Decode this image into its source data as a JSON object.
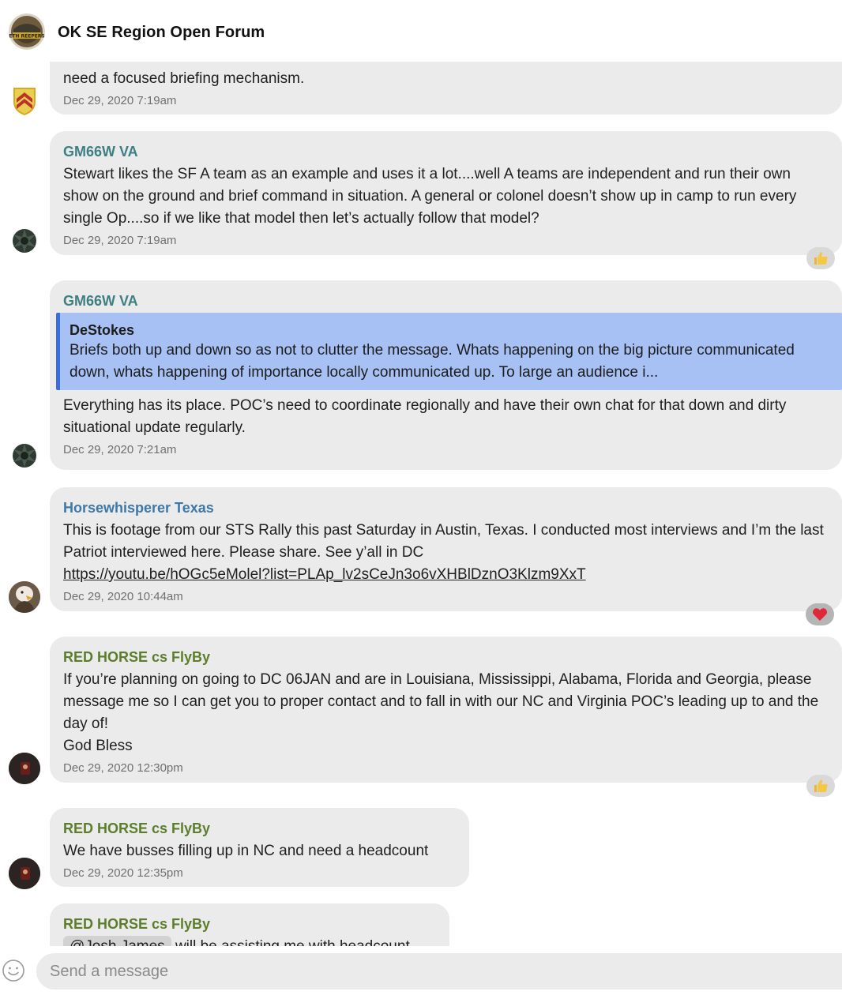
{
  "header": {
    "title": "OK SE Region Open Forum",
    "avatar_icon": "group-badge-icon"
  },
  "messages": [
    {
      "author": "",
      "body": "need a focused briefing mechanism.",
      "time": "Dec 29, 2020 7:19am",
      "avatar_icon": "chevron-shield-icon"
    },
    {
      "author": "GM66W VA",
      "body": "Stewart likes the SF A team as an example and uses it a lot....well A teams are independent and run their own show on the ground and brief command in situation.  A general or colonel doesn’t show up in camp to run every single Op....so if we like that model then let’s actually follow that model?",
      "time": "Dec 29, 2020 7:19am",
      "reaction": "thumbs-up",
      "avatar_icon": "insignia-icon"
    },
    {
      "author": "GM66W VA",
      "quote": {
        "author": "DeStokes",
        "body": "Briefs both up and down so as not to clutter the message.  Whats happening on the big picture communicated down, whats happening of importance locally communicated up. To large an audience i..."
      },
      "body": "Everything has its place.  POC’s need to coordinate regionally and have their own chat for that down and dirty situational update regularly.",
      "time": "Dec 29, 2020 7:21am",
      "avatar_icon": "insignia-icon"
    },
    {
      "author": "Horsewhisperer Texas",
      "body": "This is footage from our STS Rally this past Saturday in Austin, Texas. I conducted most interviews and I’m the last Patriot interviewed here. Please share. See y’all in DC",
      "link": "https://youtu.be/hOGc5eMolel?list=PLAp_lv2sCeJn3o6vXHBlDznO3Klzm9XxT",
      "time": "Dec 29, 2020 10:44am",
      "reaction": "heart",
      "avatar_icon": "eagle-avatar-icon"
    },
    {
      "author": "RED HORSE cs FlyBy",
      "body": "If you’re planning on going to DC 06JAN and are in Louisiana, Mississippi, Alabama, Florida and Georgia, please message me so I can get you to proper contact and to fall in with our NC and Virginia POC’s leading up to and the day of!",
      "body2": "God Bless",
      "time": "Dec 29, 2020 12:30pm",
      "reaction": "thumbs-up",
      "avatar_icon": "user-avatar-icon"
    },
    {
      "author": "RED HORSE cs FlyBy",
      "body": "We have busses filling up in NC and need a headcount",
      "time": "Dec 29, 2020 12:35pm",
      "avatar_icon": "user-avatar-icon"
    },
    {
      "author": "RED HORSE cs FlyBy",
      "mention": "@Josh James",
      "body": "will be assisting me with headcount"
    }
  ],
  "composer": {
    "placeholder": "Send a message",
    "emoji_icon": "smiley-icon"
  }
}
